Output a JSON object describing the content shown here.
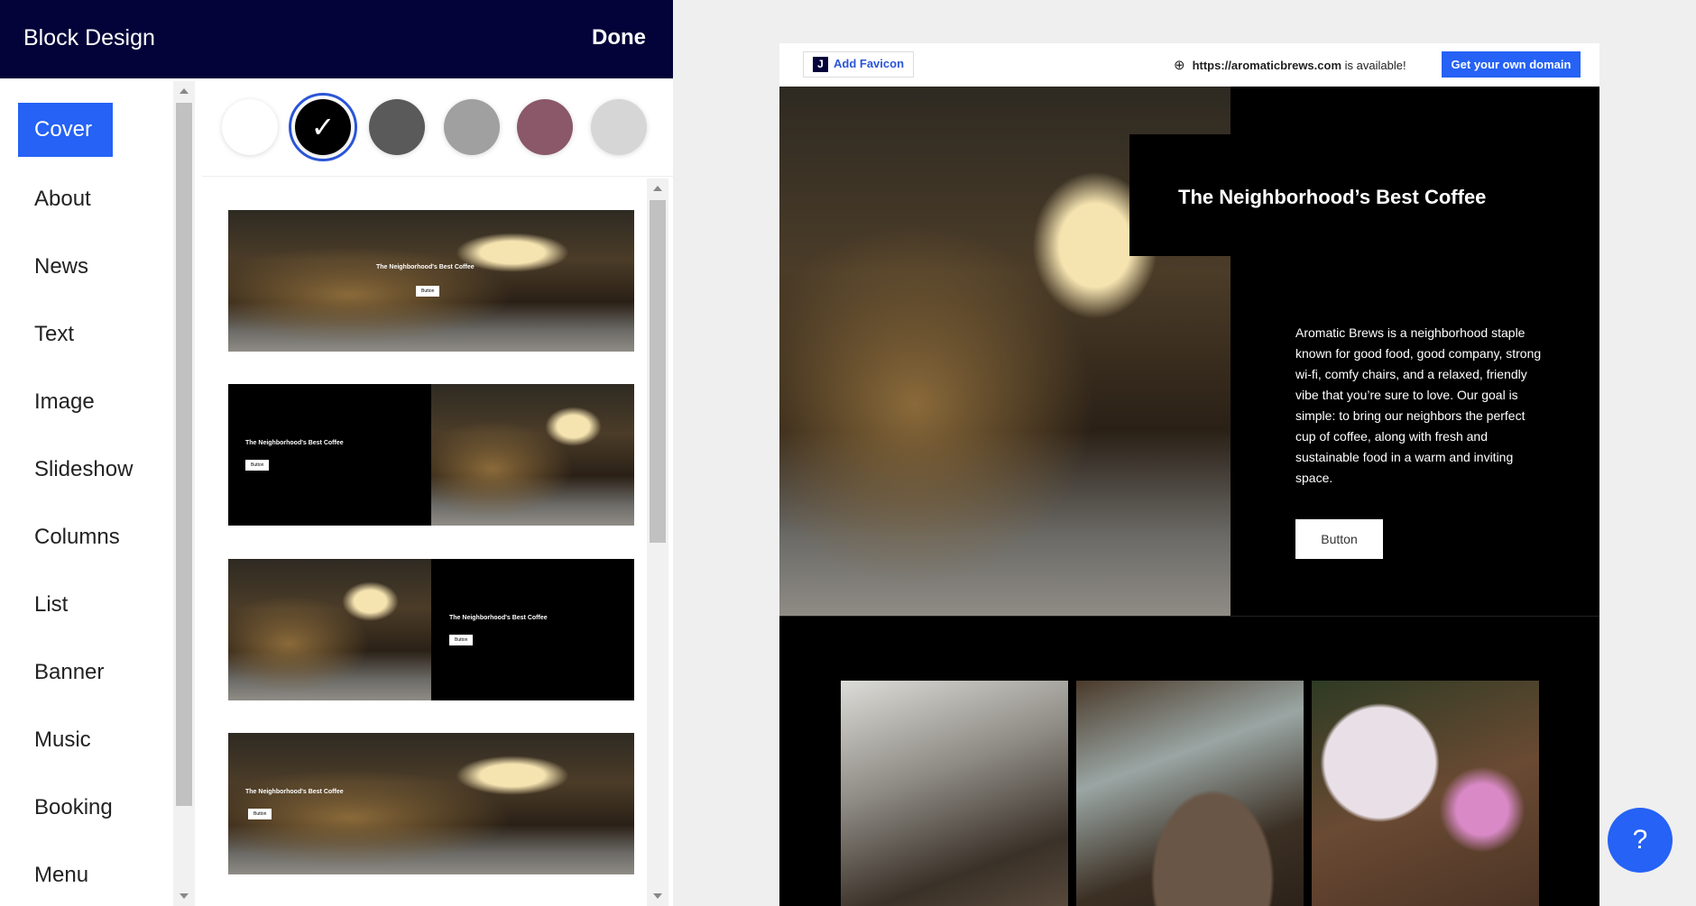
{
  "header": {
    "title": "Block Design",
    "done": "Done"
  },
  "nav": [
    {
      "label": "Cover",
      "active": true
    },
    {
      "label": "About"
    },
    {
      "label": "News"
    },
    {
      "label": "Text"
    },
    {
      "label": "Image"
    },
    {
      "label": "Slideshow"
    },
    {
      "label": "Columns"
    },
    {
      "label": "List"
    },
    {
      "label": "Banner"
    },
    {
      "label": "Music"
    },
    {
      "label": "Booking"
    },
    {
      "label": "Menu"
    }
  ],
  "swatches": [
    {
      "color": "#ffffff"
    },
    {
      "color": "#000000",
      "selected": true,
      "icon": "check-icon"
    },
    {
      "color": "#5a5a5a"
    },
    {
      "color": "#a0a0a0"
    },
    {
      "color": "#8a5868"
    },
    {
      "color": "#d6d6d6"
    }
  ],
  "check": "✓",
  "layouts": [
    {
      "title": "The Neighborhood's Best Coffee",
      "button": "Button"
    },
    {
      "title": "The Neighborhood's Best Coffee",
      "button": "Button"
    },
    {
      "title": "The Neighborhood's Best Coffee",
      "button": "Button"
    },
    {
      "title": "The Neighborhood's Best Coffee",
      "button": "Button"
    }
  ],
  "preview": {
    "favicon_letter": "J",
    "add_favicon": "Add Favicon",
    "domain": "https://aromaticbrews.com",
    "domain_suffix": " is available!",
    "get_domain": "Get your own domain",
    "title": "The Neighborhood’s Best Coffee",
    "paragraph": "Aromatic Brews is a neighborhood staple known for good food, good company, strong wi-fi, comfy chairs, and a relaxed, friendly vibe that you’re sure to love. Our goal is simple: to bring our neighbors the perfect cup of coffee, along with fresh and sustainable food in a warm and inviting space.",
    "button": "Button"
  },
  "help": "?",
  "colors": {
    "brand": "#2562f5",
    "header": "#03033a"
  }
}
